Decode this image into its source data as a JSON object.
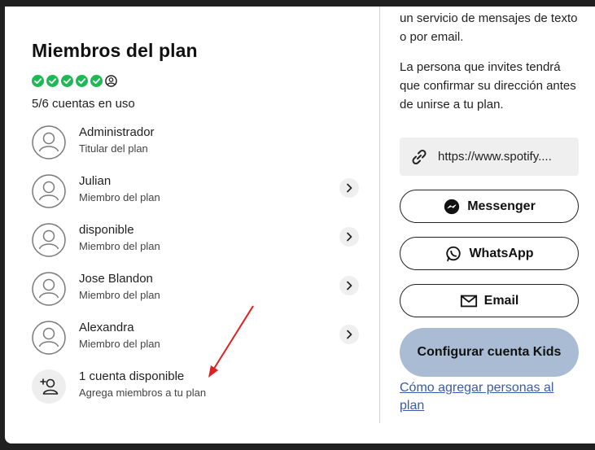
{
  "plan": {
    "title": "Miembros del plan",
    "usage": "5/6 cuentas en uso",
    "slot_status": [
      "used",
      "used",
      "used",
      "used",
      "used",
      "open"
    ],
    "accent_color": "#1db954"
  },
  "members": [
    {
      "name": "Administrador",
      "role": "Titular del plan",
      "has_chevron": false
    },
    {
      "name": "Julian",
      "role": "Miembro del plan",
      "has_chevron": true
    },
    {
      "name": "disponible",
      "role": "Miembro del plan",
      "has_chevron": true
    },
    {
      "name": "Jose Blandon",
      "role": "Miembro del plan",
      "has_chevron": true
    },
    {
      "name": "Alexandra",
      "role": "Miembro del plan",
      "has_chevron": true
    }
  ],
  "add_member": {
    "title": "1 cuenta disponible",
    "subtitle": "Agrega miembros a tu plan"
  },
  "invite": {
    "text_top": "un servicio de mensajes de texto o por email.",
    "text_confirm": "La persona que invites tendrá que confirmar su dirección antes de unirse a tu plan.",
    "link": "https://www.spotify....",
    "messenger": "Messenger",
    "whatsapp": "WhatsApp",
    "email": "Email",
    "kids_button": "Configurar cuenta Kids",
    "help_link": "Cómo agregar personas al plan"
  },
  "annotation": {
    "arrow_color": "#e02020"
  }
}
